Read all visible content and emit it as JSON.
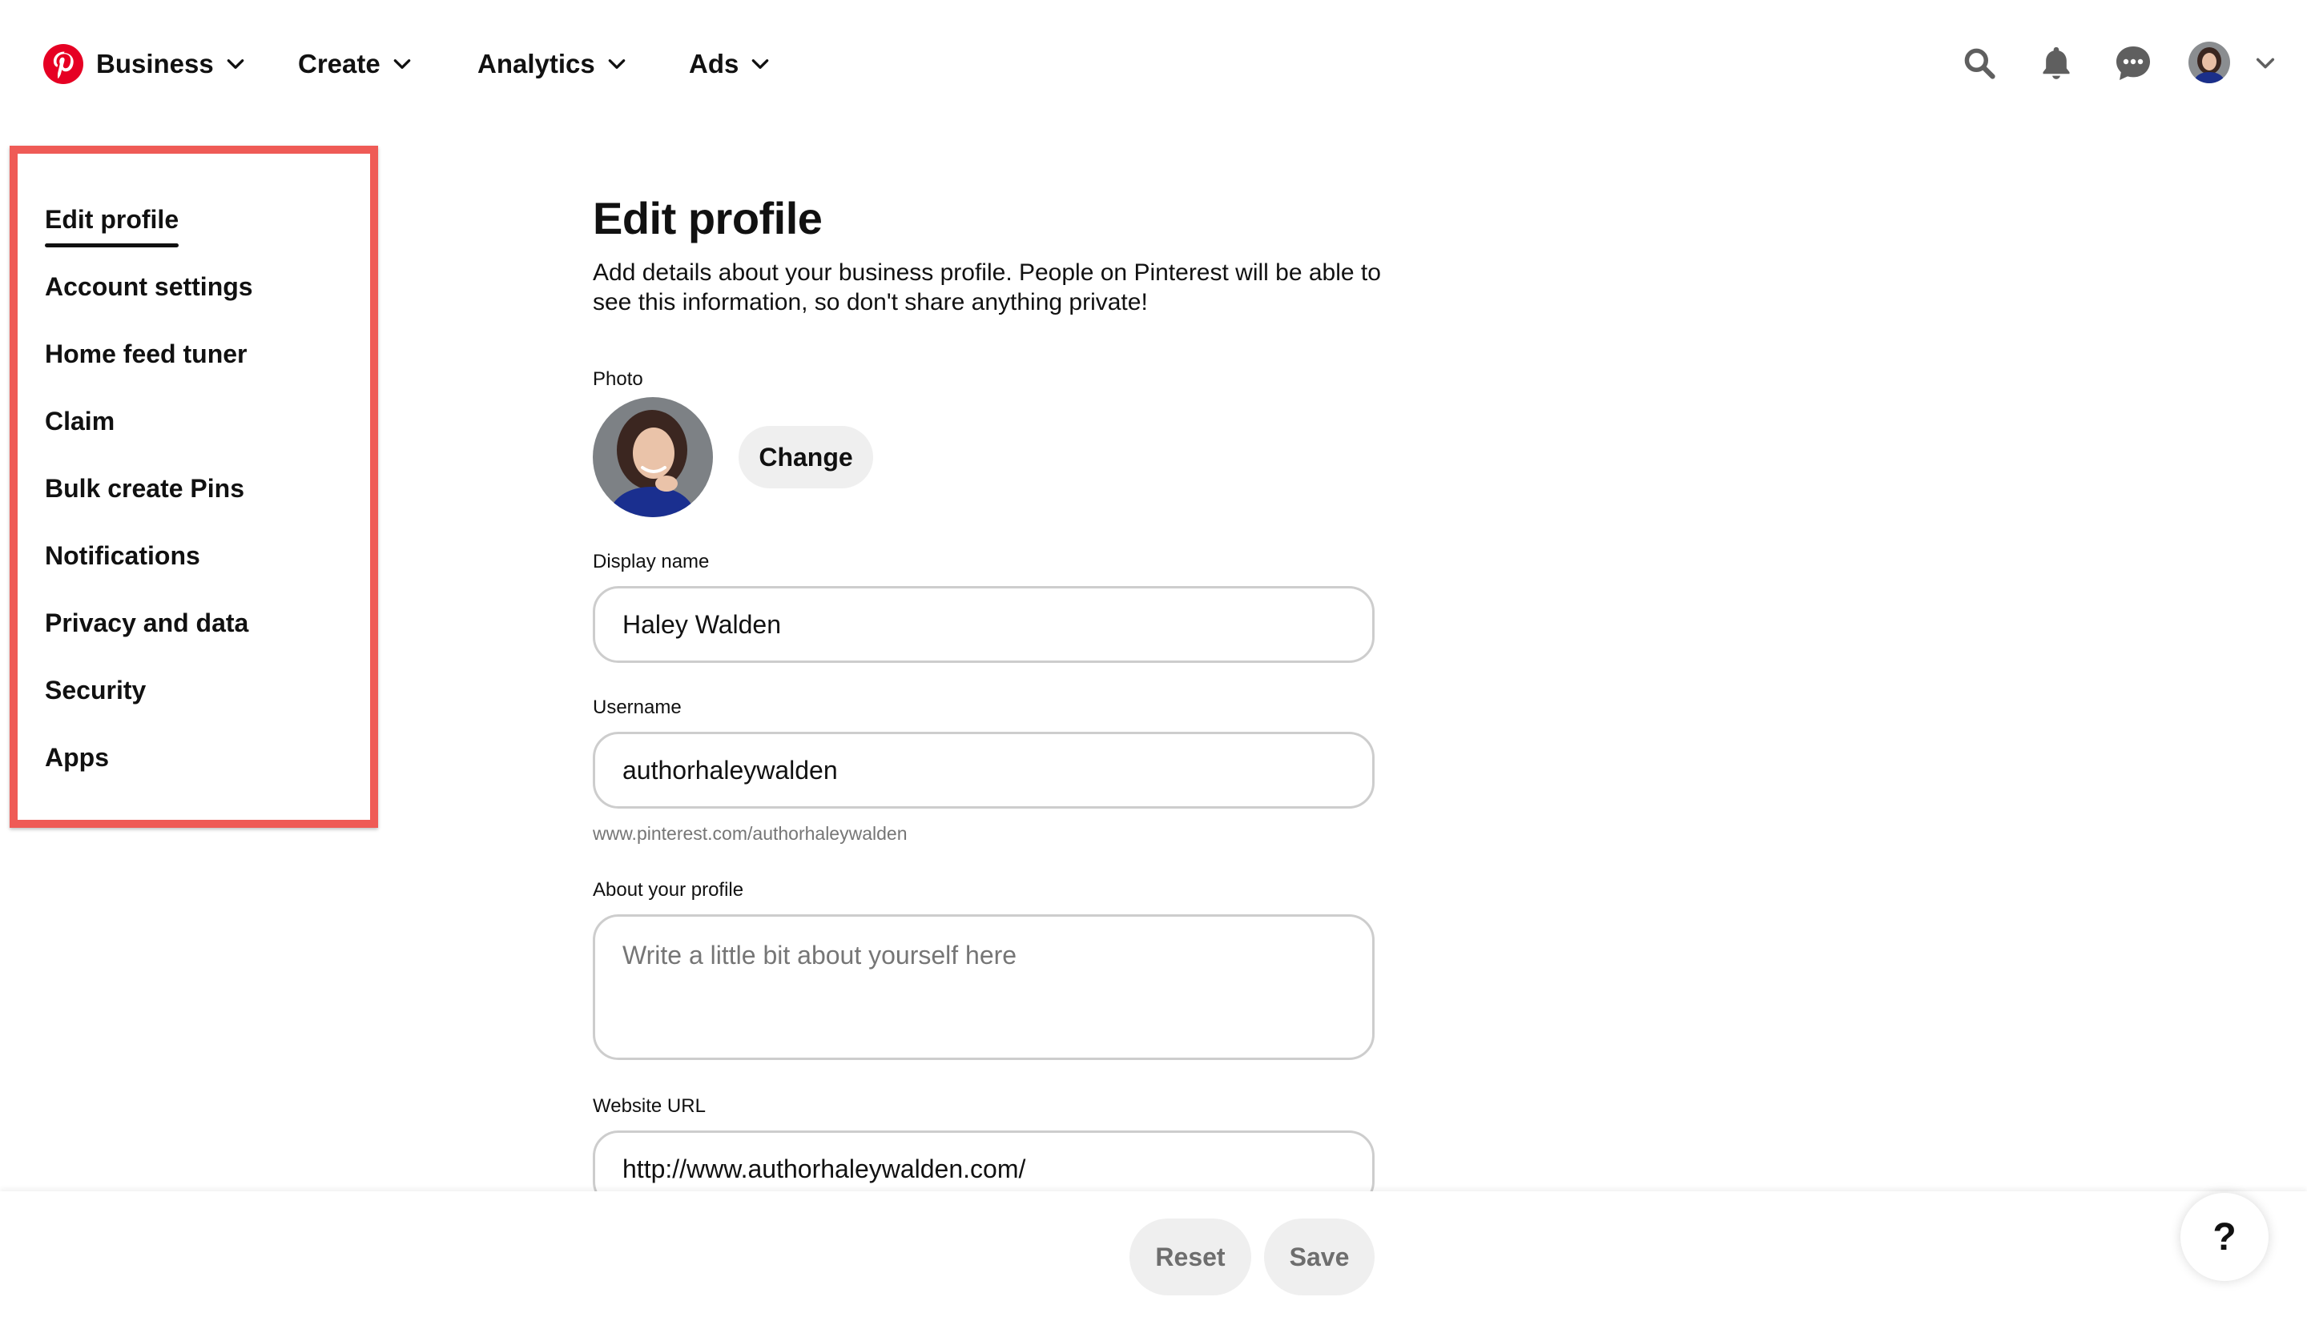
{
  "nav": {
    "business_label": "Business",
    "create_label": "Create",
    "analytics_label": "Analytics",
    "ads_label": "Ads",
    "icons": [
      "pinterest-logo",
      "search-icon",
      "bell-icon",
      "chat-icon",
      "avatar",
      "chevron-down-icon"
    ]
  },
  "sidebar": {
    "items": [
      {
        "label": "Edit profile",
        "active": true
      },
      {
        "label": "Account settings"
      },
      {
        "label": "Home feed tuner"
      },
      {
        "label": "Claim"
      },
      {
        "label": "Bulk create Pins"
      },
      {
        "label": "Notifications"
      },
      {
        "label": "Privacy and data"
      },
      {
        "label": "Security"
      },
      {
        "label": "Apps"
      }
    ],
    "highlight_color": "#ef5b56"
  },
  "main": {
    "title": "Edit profile",
    "description": "Add details about your business profile. People on Pinterest will be able to see this information, so don't share anything private!",
    "photo_label": "Photo",
    "change_label": "Change",
    "display_name_label": "Display name",
    "display_name_value": "Haley Walden",
    "username_label": "Username",
    "username_value": "authorhaleywalden",
    "username_url": "www.pinterest.com/authorhaleywalden",
    "about_label": "About your profile",
    "about_placeholder": "Write a little bit about yourself here",
    "website_label": "Website URL",
    "website_value": "http://www.authorhaleywalden.com/"
  },
  "footer": {
    "reset_label": "Reset",
    "save_label": "Save",
    "help_label": "?"
  },
  "colors": {
    "brand": "#e60023",
    "text": "#111111",
    "muted": "#767676",
    "button_bg": "#efefef"
  }
}
